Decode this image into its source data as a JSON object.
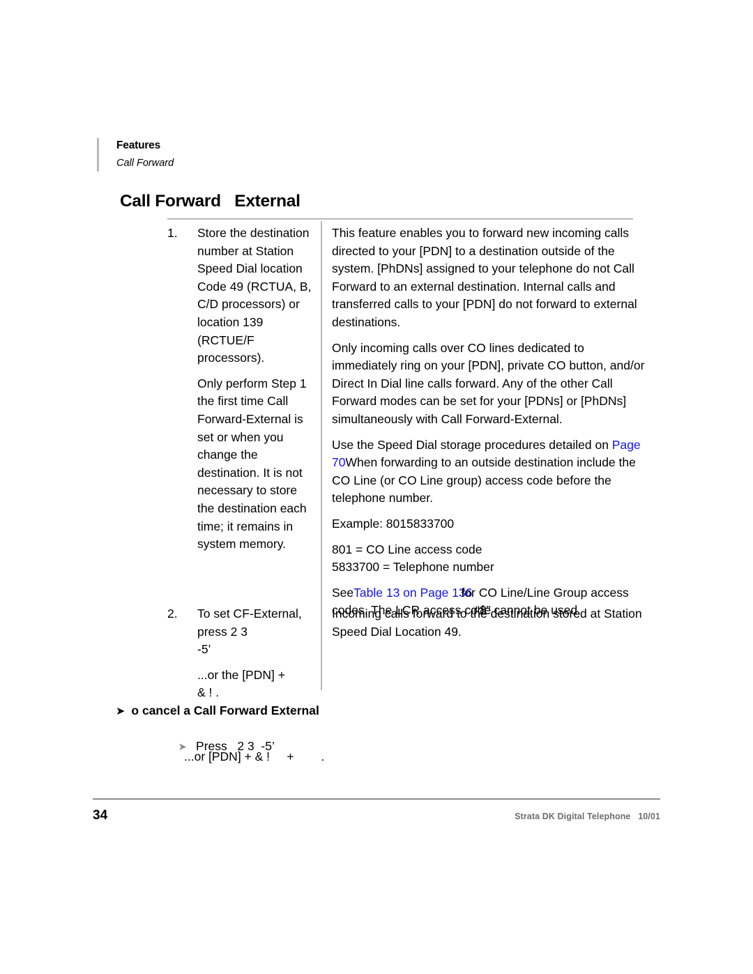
{
  "running_header": {
    "title": "Features",
    "subtitle": "Call Forward"
  },
  "page_heading": "Call Forward   External",
  "procedure": {
    "steps": [
      {
        "number": "1.",
        "paragraphs": [
          "Store the destination number at Station Speed Dial location Code 49 (RCTUA, B, C/D processors) or location 139 (RCTUE/F processors).",
          "Only perform Step 1 the first time Call Forward-External is set or when you change the destination. It is not necessary to store the destination each time; it remains in system memory."
        ]
      },
      {
        "number": "2.",
        "paragraphs": [
          "To set CF-External, press   2 3",
          "-5’",
          "...or the [PDN] +",
          "& !   ."
        ]
      }
    ],
    "right_column": {
      "step1_paragraphs": [
        "This feature enables you to forward new incoming calls directed to your [PDN] to a destination outside of the system. [PhDNs] assigned to your telephone do not Call Forward to an external destination. Internal calls and transferred calls to your [PDN] do not forward to external destinations.",
        "Only incoming calls over CO lines dedicated to immediately ring on your [PDN], private CO button, and/or Direct In Dial line calls forward. Any of the other Call Forward modes can be set for your [PDNs] or [PhDNs] simultaneously with Call Forward-External."
      ],
      "speed_dial_lead": "Use the Speed Dial storage procedures detailed on ",
      "speed_dial_link": "Page 70",
      "speed_dial_tail": "When forwarding to an outside destination include the CO Line (or CO Line group) access code before the telephone number.",
      "example_line": "Example: 8015833700",
      "example_parts": [
        "801 = CO Line access code",
        "5833700 = Telephone number"
      ],
      "see_lead": "See",
      "see_link": "Table 13 on Page 136",
      "see_mid": "for CO Line/Line Group access codes. The LCR access code ",
      "see_quote": "“8”",
      "see_tail": " cannot be used.",
      "step2_paragraph": "Incoming calls forward to the destination stored at Station Speed Dial Location 49."
    }
  },
  "cancel_section": {
    "arrow": "➤",
    "heading": "o cancel a Call Forward External",
    "step_arrow": "➤",
    "step_label": "Press",
    "step_codes": "2 3  -5’",
    "alt_line": "...or [PDN] + & !     +        ."
  },
  "footer": {
    "folio": "34",
    "text": "Strata DK Digital Telephone   10/01"
  },
  "colors": {
    "link": "#1515e0",
    "rule": "#b9b9b9",
    "footer_text": "#6d6d6d"
  }
}
